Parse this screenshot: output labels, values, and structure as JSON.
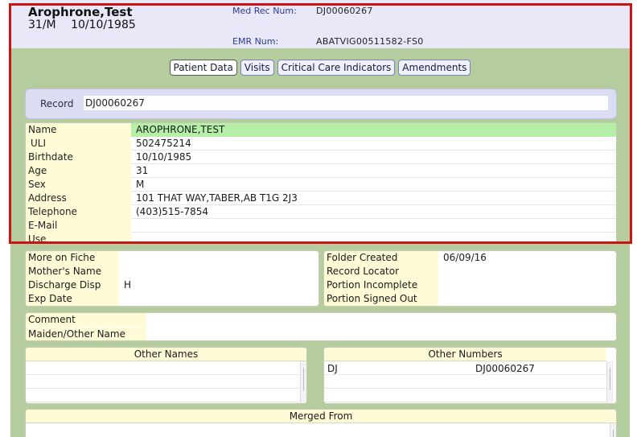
{
  "patient": {
    "name": "Arophrone,Test",
    "age_sex": "31/M",
    "dob": "10/10/1985"
  },
  "header": {
    "med_rec_label": "Med Rec Num:",
    "med_rec_value": "DJ00060267",
    "emr_label": "EMR Num:",
    "emr_value": "ABATVIG00511582-FS0"
  },
  "tabs": [
    {
      "label": "Patient Data",
      "active": true
    },
    {
      "label": "Visits",
      "active": false
    },
    {
      "label": "Critical Care Indicators",
      "active": false
    },
    {
      "label": "Amendments",
      "active": false
    }
  ],
  "record": {
    "label": "Record",
    "value": "DJ00060267"
  },
  "demographics": [
    {
      "label": "Name",
      "value": "AROPHRONE,TEST",
      "selected": true
    },
    {
      "label": "ULI",
      "value": "502475214"
    },
    {
      "label": "Birthdate",
      "value": "10/10/1985"
    },
    {
      "label": "Age",
      "value": "31"
    },
    {
      "label": "Sex",
      "value": "M"
    },
    {
      "label": "Address",
      "value": "101 THAT WAY,TABER,AB T1G 2J3"
    },
    {
      "label": "Telephone",
      "value": "(403)515-7854"
    },
    {
      "label": "E-Mail",
      "value": ""
    },
    {
      "label": "Use",
      "value": ""
    }
  ],
  "fiche": [
    {
      "label": "More on Fiche",
      "value": ""
    },
    {
      "label": "Mother's Name",
      "value": ""
    },
    {
      "label": "Discharge Disp",
      "value": "H"
    },
    {
      "label": "Exp Date",
      "value": ""
    }
  ],
  "folder": [
    {
      "label": "Folder Created",
      "value": "06/09/16"
    },
    {
      "label": "Record Locator",
      "value": ""
    },
    {
      "label": "Portion Incomplete",
      "value": ""
    },
    {
      "label": "Portion Signed Out",
      "value": ""
    }
  ],
  "comments": [
    {
      "label": "Comment",
      "value": ""
    },
    {
      "label": "Maiden/Other Name",
      "value": ""
    }
  ],
  "other_names": {
    "header": "Other Names",
    "rows": []
  },
  "other_numbers": {
    "header": "Other Numbers",
    "rows": [
      {
        "type": "DJ",
        "number": "DJ00060267"
      }
    ]
  },
  "merged_from": {
    "header": "Merged From"
  },
  "colors": {
    "header_bg": "#e8e8f8",
    "panel_green": "#b5cc9f",
    "label_yellow": "#fffbd7",
    "selected_green": "#b6f0a8",
    "highlight_red": "#cc1414"
  }
}
